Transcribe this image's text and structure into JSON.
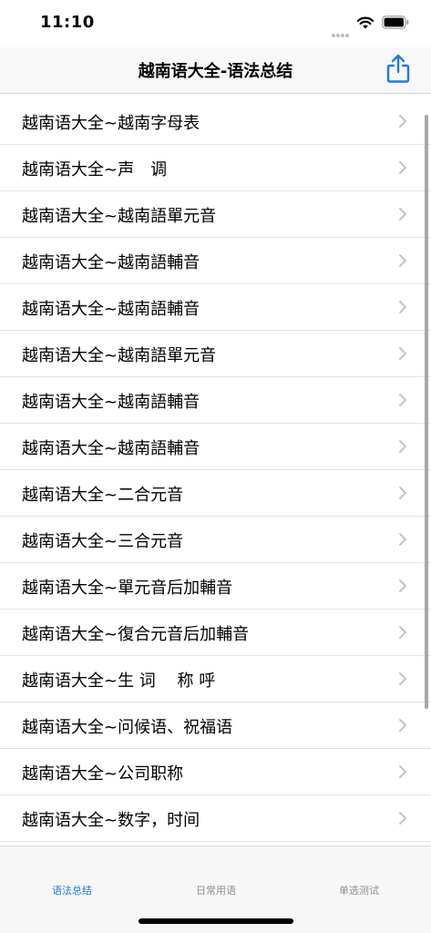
{
  "status_bar": {
    "time": "11:10"
  },
  "nav": {
    "title": "越南语大全-语法总结",
    "share_icon": "share-icon"
  },
  "list": {
    "items": [
      "越南语大全~越南字母表",
      "越南语大全~声　调",
      "越南语大全~越南語單元音",
      "越南语大全~越南語輔音",
      "越南语大全~越南語輔音",
      "越南语大全~越南語單元音",
      "越南语大全~越南語輔音",
      "越南语大全~越南語輔音",
      "越南语大全~二合元音",
      "越南语大全~三合元音",
      "越南语大全~單元音后加輔音",
      "越南语大全~復合元音后加輔音",
      "越南语大全~生 词　 称 呼",
      "越南语大全~问候语、祝福语",
      "越南语大全~公司职称",
      "越南语大全~数字，时间"
    ]
  },
  "tabs": [
    {
      "label": "语法总结",
      "active": true
    },
    {
      "label": "日常用语",
      "active": false
    },
    {
      "label": "单选测试",
      "active": false
    }
  ],
  "colors": {
    "accent": "#1e7ae5",
    "tab_inactive": "#8e8e93",
    "chevron": "#c4c4c7"
  }
}
